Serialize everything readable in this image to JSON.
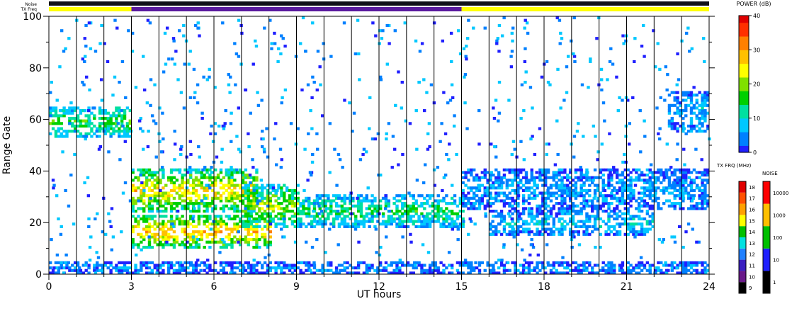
{
  "chart_data": {
    "type": "heatmap",
    "title": "",
    "xlabel": "UT hours",
    "ylabel": "Range Gate",
    "xlim": [
      0,
      24
    ],
    "ylim": [
      0,
      100
    ],
    "x_ticks": [
      "0",
      "3",
      "6",
      "9",
      "12",
      "15",
      "18",
      "21",
      "24"
    ],
    "y_ticks": [
      "0",
      "20",
      "40",
      "60",
      "80",
      "100"
    ],
    "top_bars": {
      "noise_label": "Noise",
      "txfreq_label": "TX Freq",
      "txfreq_segments": [
        {
          "from": 0,
          "to": 3,
          "color": "#ffff00"
        },
        {
          "from": 3,
          "to": 15,
          "color": "#5a1a9e"
        },
        {
          "from": 15,
          "to": 24,
          "color": "#ffff00"
        }
      ]
    },
    "scan_boundaries_ut": [
      1,
      2,
      3,
      4,
      5,
      6,
      7,
      8,
      9,
      10,
      11,
      12,
      13,
      14,
      15,
      16,
      17,
      18,
      19,
      20,
      21,
      22,
      23
    ],
    "echo_bands": [
      {
        "t0": 0.0,
        "t1": 3.0,
        "g0": 53,
        "g1": 64,
        "power": 14
      },
      {
        "t0": 3.0,
        "t1": 7.5,
        "g0": 24,
        "g1": 40,
        "power": 22
      },
      {
        "t0": 3.0,
        "t1": 8.0,
        "g0": 10,
        "g1": 22,
        "power": 24
      },
      {
        "t0": 7.0,
        "t1": 9.0,
        "g0": 18,
        "g1": 34,
        "power": 18
      },
      {
        "t0": 9.0,
        "t1": 15.0,
        "g0": 18,
        "g1": 30,
        "power": 12
      },
      {
        "t0": 15.0,
        "t1": 24.0,
        "g0": 25,
        "g1": 40,
        "power": 5
      },
      {
        "t0": 16.0,
        "t1": 22.0,
        "g0": 15,
        "g1": 24,
        "power": 7
      },
      {
        "t0": 22.5,
        "t1": 24.0,
        "g0": 55,
        "g1": 70,
        "power": 6
      },
      {
        "t0": 0.0,
        "t1": 24.0,
        "g0": 0,
        "g1": 4,
        "power": 4
      }
    ],
    "colorbars": {
      "power": {
        "label": "POWER (dB)",
        "ticks": [
          "0",
          "10",
          "20",
          "30",
          "40"
        ],
        "colors": [
          "#2020ff",
          "#0080ff",
          "#00c8ff",
          "#00e0a0",
          "#00d000",
          "#80e000",
          "#ffff00",
          "#ffc000",
          "#ff8000",
          "#ff3000",
          "#e00000"
        ]
      },
      "txfreq": {
        "label": "TX FRQ (MHz)",
        "ticks": [
          "9",
          "10",
          "11",
          "12",
          "13",
          "14",
          "15",
          "16",
          "17",
          "18"
        ],
        "colors": [
          "#000000",
          "#6a1a8a",
          "#3a20c0",
          "#2080ff",
          "#00e0e0",
          "#00c000",
          "#ffff00",
          "#ffa000",
          "#ff5000",
          "#e00000"
        ]
      },
      "noise": {
        "label": "NOISE",
        "ticks": [
          "1",
          "10",
          "100",
          "1000",
          "10000"
        ],
        "colors": [
          "#000000",
          "#2020ff",
          "#00c000",
          "#ffc000",
          "#ff0000"
        ]
      }
    }
  }
}
